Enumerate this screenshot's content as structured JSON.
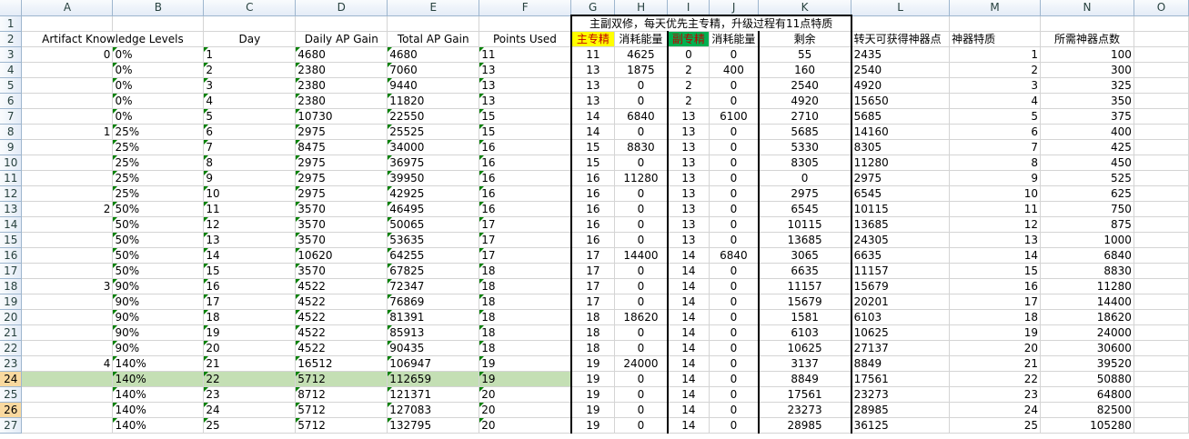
{
  "columns": [
    "A",
    "B",
    "C",
    "D",
    "E",
    "F",
    "G",
    "H",
    "I",
    "J",
    "K",
    "L",
    "M",
    "N",
    "O"
  ],
  "row_numbers": [
    1,
    2,
    3,
    4,
    5,
    6,
    7,
    8,
    9,
    10,
    11,
    12,
    13,
    14,
    15,
    16,
    17,
    18,
    19,
    20,
    21,
    22,
    23,
    24,
    25,
    26,
    27
  ],
  "title_cell": "主副双修，每天优先主专精，升级过程有11点特质",
  "headers": {
    "A": "Artifact Knowledge Levels",
    "C": "Day",
    "D": "Daily AP Gain",
    "E": "Total AP Gain",
    "F": "Points Used",
    "G": "主专精",
    "H": "消耗能量",
    "I": "副专精",
    "J": "消耗能量",
    "K": "剩余",
    "L": "转天可获得神器点",
    "M": "神器特质",
    "N": "所需神器点数"
  },
  "colors": {
    "main_spec": "#ffff00",
    "off_spec": "#00b050",
    "highlight_row": "#c4dfb4"
  },
  "rows": [
    {
      "a": "0",
      "b": "0%",
      "c": "1",
      "d": "4680",
      "e": "4680",
      "f": "11",
      "g": "11",
      "h": "4625",
      "i": "0",
      "j": "0",
      "k": "55",
      "l": "2435",
      "m": "1",
      "n": "100"
    },
    {
      "a": "",
      "b": "0%",
      "c": "2",
      "d": "2380",
      "e": "7060",
      "f": "13",
      "g": "13",
      "h": "1875",
      "i": "2",
      "j": "400",
      "k": "160",
      "l": "2540",
      "m": "2",
      "n": "300"
    },
    {
      "a": "",
      "b": "0%",
      "c": "3",
      "d": "2380",
      "e": "9440",
      "f": "13",
      "g": "13",
      "h": "0",
      "i": "2",
      "j": "0",
      "k": "2540",
      "l": "4920",
      "m": "3",
      "n": "325"
    },
    {
      "a": "",
      "b": "0%",
      "c": "4",
      "d": "2380",
      "e": "11820",
      "f": "13",
      "g": "13",
      "h": "0",
      "i": "2",
      "j": "0",
      "k": "4920",
      "l": "15650",
      "m": "4",
      "n": "350"
    },
    {
      "a": "",
      "b": "0%",
      "c": "5",
      "d": "10730",
      "e": "22550",
      "f": "15",
      "g": "14",
      "h": "6840",
      "i": "13",
      "j": "6100",
      "k": "2710",
      "l": "5685",
      "m": "5",
      "n": "375"
    },
    {
      "a": "1",
      "b": "25%",
      "c": "6",
      "d": "2975",
      "e": "25525",
      "f": "15",
      "g": "14",
      "h": "0",
      "i": "13",
      "j": "0",
      "k": "5685",
      "l": "14160",
      "m": "6",
      "n": "400"
    },
    {
      "a": "",
      "b": "25%",
      "c": "7",
      "d": "8475",
      "e": "34000",
      "f": "16",
      "g": "15",
      "h": "8830",
      "i": "13",
      "j": "0",
      "k": "5330",
      "l": "8305",
      "m": "7",
      "n": "425"
    },
    {
      "a": "",
      "b": "25%",
      "c": "8",
      "d": "2975",
      "e": "36975",
      "f": "16",
      "g": "15",
      "h": "0",
      "i": "13",
      "j": "0",
      "k": "8305",
      "l": "11280",
      "m": "8",
      "n": "450"
    },
    {
      "a": "",
      "b": "25%",
      "c": "9",
      "d": "2975",
      "e": "39950",
      "f": "16",
      "g": "16",
      "h": "11280",
      "i": "13",
      "j": "0",
      "k": "0",
      "l": "2975",
      "m": "9",
      "n": "525"
    },
    {
      "a": "",
      "b": "25%",
      "c": "10",
      "d": "2975",
      "e": "42925",
      "f": "16",
      "g": "16",
      "h": "0",
      "i": "13",
      "j": "0",
      "k": "2975",
      "l": "6545",
      "m": "10",
      "n": "625"
    },
    {
      "a": "2",
      "b": "50%",
      "c": "11",
      "d": "3570",
      "e": "46495",
      "f": "16",
      "g": "16",
      "h": "0",
      "i": "13",
      "j": "0",
      "k": "6545",
      "l": "10115",
      "m": "11",
      "n": "750"
    },
    {
      "a": "",
      "b": "50%",
      "c": "12",
      "d": "3570",
      "e": "50065",
      "f": "17",
      "g": "16",
      "h": "0",
      "i": "13",
      "j": "0",
      "k": "10115",
      "l": "13685",
      "m": "12",
      "n": "875"
    },
    {
      "a": "",
      "b": "50%",
      "c": "13",
      "d": "3570",
      "e": "53635",
      "f": "17",
      "g": "16",
      "h": "0",
      "i": "13",
      "j": "0",
      "k": "13685",
      "l": "24305",
      "m": "13",
      "n": "1000"
    },
    {
      "a": "",
      "b": "50%",
      "c": "14",
      "d": "10620",
      "e": "64255",
      "f": "17",
      "g": "17",
      "h": "14400",
      "i": "14",
      "j": "6840",
      "k": "3065",
      "l": "6635",
      "m": "14",
      "n": "6840"
    },
    {
      "a": "",
      "b": "50%",
      "c": "15",
      "d": "3570",
      "e": "67825",
      "f": "18",
      "g": "17",
      "h": "0",
      "i": "14",
      "j": "0",
      "k": "6635",
      "l": "11157",
      "m": "15",
      "n": "8830"
    },
    {
      "a": "3",
      "b": "90%",
      "c": "16",
      "d": "4522",
      "e": "72347",
      "f": "18",
      "g": "17",
      "h": "0",
      "i": "14",
      "j": "0",
      "k": "11157",
      "l": "15679",
      "m": "16",
      "n": "11280"
    },
    {
      "a": "",
      "b": "90%",
      "c": "17",
      "d": "4522",
      "e": "76869",
      "f": "18",
      "g": "17",
      "h": "0",
      "i": "14",
      "j": "0",
      "k": "15679",
      "l": "20201",
      "m": "17",
      "n": "14400"
    },
    {
      "a": "",
      "b": "90%",
      "c": "18",
      "d": "4522",
      "e": "81391",
      "f": "18",
      "g": "18",
      "h": "18620",
      "i": "14",
      "j": "0",
      "k": "1581",
      "l": "6103",
      "m": "18",
      "n": "18620"
    },
    {
      "a": "",
      "b": "90%",
      "c": "19",
      "d": "4522",
      "e": "85913",
      "f": "18",
      "g": "18",
      "h": "0",
      "i": "14",
      "j": "0",
      "k": "6103",
      "l": "10625",
      "m": "19",
      "n": "24000"
    },
    {
      "a": "",
      "b": "90%",
      "c": "20",
      "d": "4522",
      "e": "90435",
      "f": "18",
      "g": "18",
      "h": "0",
      "i": "14",
      "j": "0",
      "k": "10625",
      "l": "27137",
      "m": "20",
      "n": "30600"
    },
    {
      "a": "4",
      "b": "140%",
      "c": "21",
      "d": "16512",
      "e": "106947",
      "f": "19",
      "g": "19",
      "h": "24000",
      "i": "14",
      "j": "0",
      "k": "3137",
      "l": "8849",
      "m": "21",
      "n": "39520"
    },
    {
      "a": "",
      "b": "140%",
      "c": "22",
      "d": "5712",
      "e": "112659",
      "f": "19",
      "g": "19",
      "h": "0",
      "i": "14",
      "j": "0",
      "k": "8849",
      "l": "17561",
      "m": "22",
      "n": "50880"
    },
    {
      "a": "",
      "b": "140%",
      "c": "23",
      "d": "8712",
      "e": "121371",
      "f": "20",
      "g": "19",
      "h": "0",
      "i": "14",
      "j": "0",
      "k": "17561",
      "l": "23273",
      "m": "23",
      "n": "64800"
    },
    {
      "a": "",
      "b": "140%",
      "c": "24",
      "d": "5712",
      "e": "127083",
      "f": "20",
      "g": "19",
      "h": "0",
      "i": "14",
      "j": "0",
      "k": "23273",
      "l": "28985",
      "m": "24",
      "n": "82500"
    },
    {
      "a": "",
      "b": "140%",
      "c": "25",
      "d": "5712",
      "e": "132795",
      "f": "20",
      "g": "19",
      "h": "0",
      "i": "14",
      "j": "0",
      "k": "28985",
      "l": "36125",
      "m": "25",
      "n": "105280"
    }
  ]
}
